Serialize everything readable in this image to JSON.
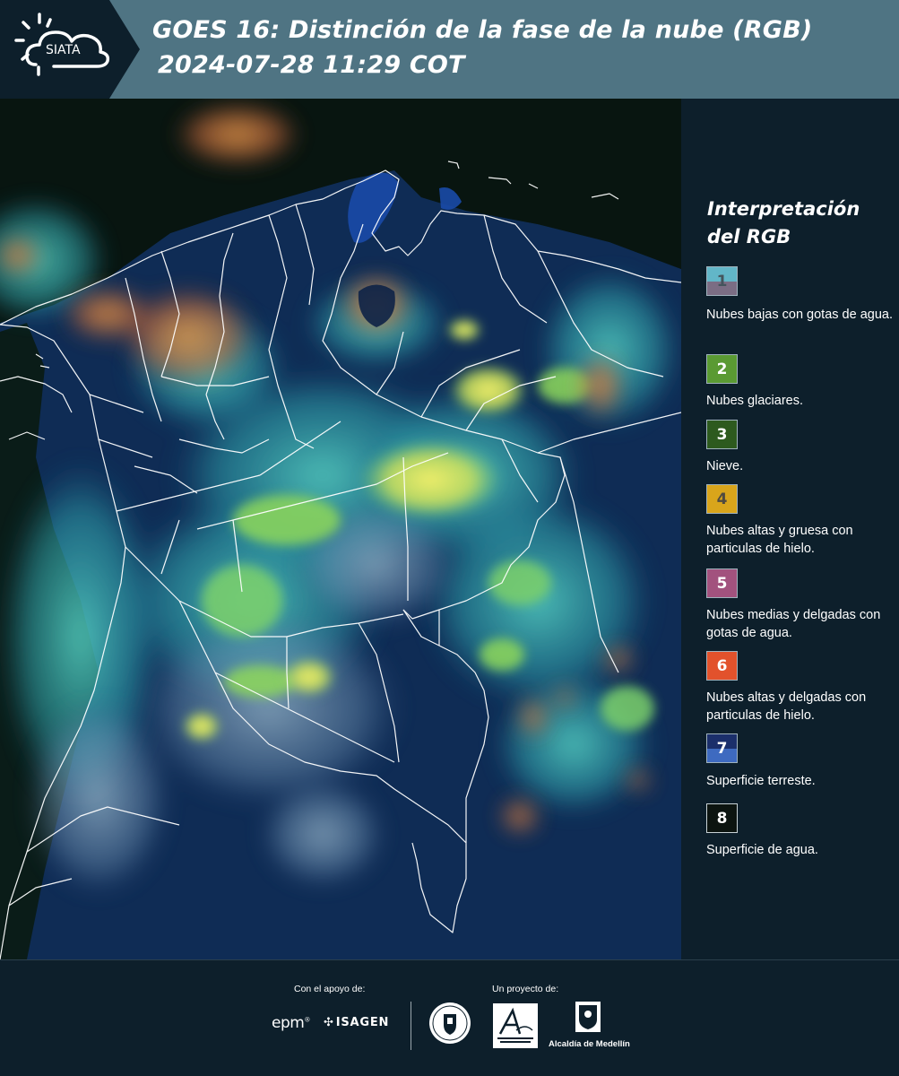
{
  "header": {
    "logo_text": "SIATA",
    "title_line1": "GOES 16: Distinción de la fase de la nube (RGB)",
    "title_line2": "2024-07-28 11:29 COT"
  },
  "legend": {
    "title": "Interpretación del RGB",
    "items": [
      {
        "number": "1",
        "text": "Nubes bajas con gotas de agua.",
        "color_top": "#62b6c8",
        "color_bottom": "#7b6d84"
      },
      {
        "number": "2",
        "text": "Nubes glaciares.",
        "color": "#5a9a33"
      },
      {
        "number": "3",
        "text": "Nieve.",
        "color": "#2d5a1e"
      },
      {
        "number": "4",
        "text": "Nubes altas y gruesa con particulas de hielo.",
        "color": "#d9a51b"
      },
      {
        "number": "5",
        "text": "Nubes medias y delgadas con gotas de agua.",
        "color": "#a2527e"
      },
      {
        "number": "6",
        "text": "Nubes altas y delgadas con particulas de hielo.",
        "color": "#e2522c"
      },
      {
        "number": "7",
        "text": "Superficie terreste.",
        "color_top": "#1b2f6b",
        "color_bottom": "#3e6ac0"
      },
      {
        "number": "8",
        "text": "Superficie de agua.",
        "color": "#0c1410"
      }
    ]
  },
  "footer": {
    "support_label": "Con el apoyo de:",
    "project_label": "Un proyecto de:",
    "sponsor_1": "epm",
    "sponsor_2": "ISAGEN",
    "partner_amva": "Área Metropolitana Valle de Aburrá",
    "partner_alcaldia": "Alcaldía de Medellín"
  },
  "colors": {
    "header_bg": "#4f7483",
    "panel_bg": "#0d1f2b",
    "land": "#0d2a4a",
    "water": "#08101a",
    "cloud_cyan": "#3fc9c3",
    "cloud_green": "#9ee25a",
    "cloud_yellow": "#e7e35a",
    "cloud_orange": "#d9793d"
  }
}
